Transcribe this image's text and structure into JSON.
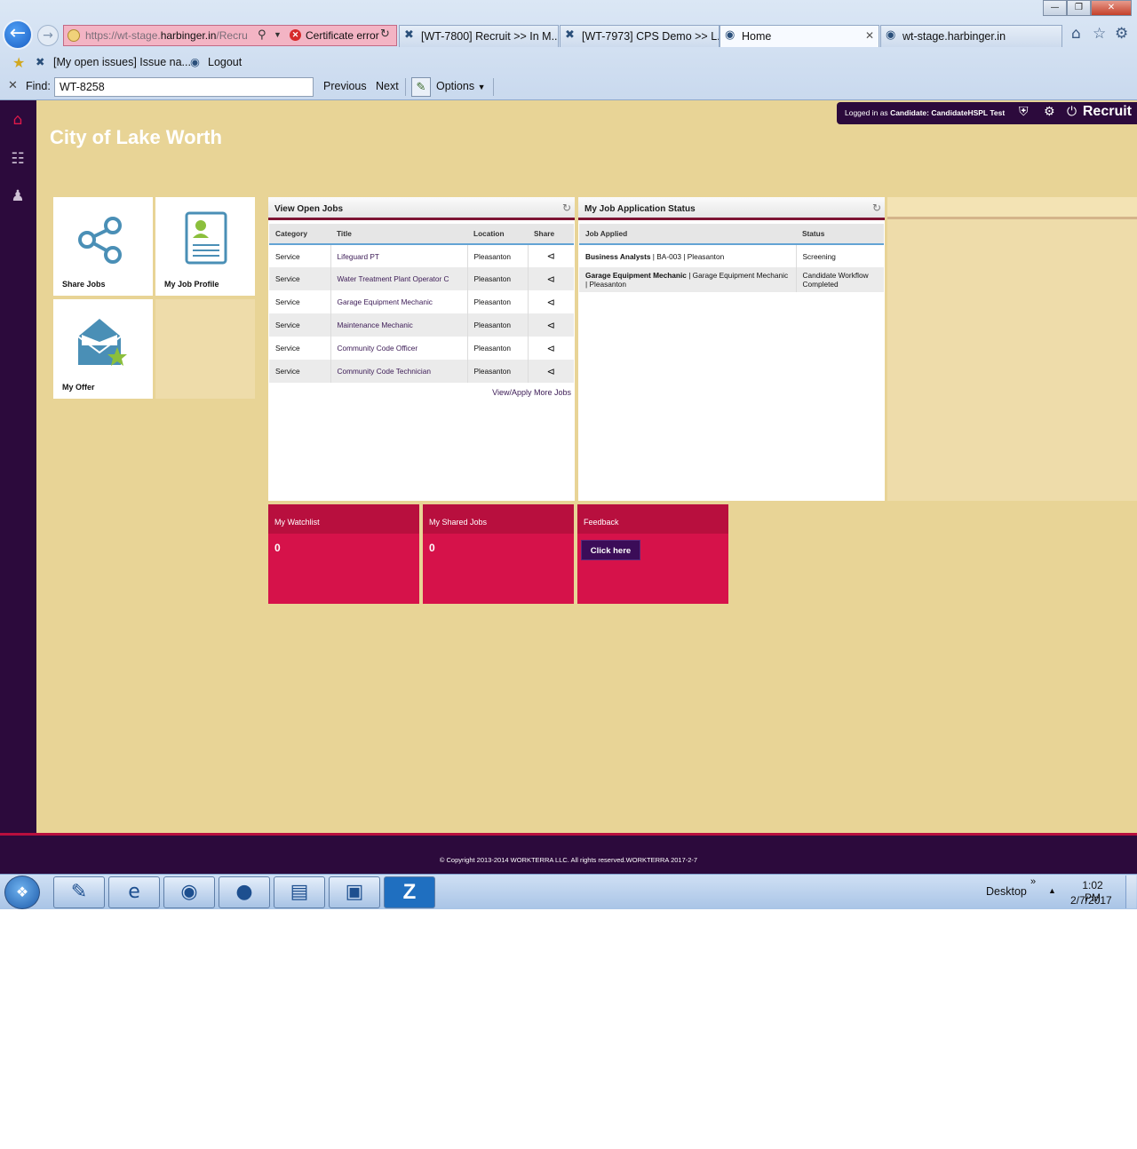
{
  "browser": {
    "url_prefix": "https://wt-stage.",
    "url_domain": "harbinger.in",
    "url_suffix": "/Recru",
    "cert_error": "Certificate error",
    "tabs": [
      {
        "label": "[WT-7800] Recruit >> In M..."
      },
      {
        "label": "[WT-7973] CPS Demo >> L..."
      },
      {
        "label": "Home"
      },
      {
        "label": "wt-stage.harbinger.in"
      }
    ],
    "favorites": [
      {
        "label": "[My open issues] Issue na..."
      },
      {
        "label": "Logout"
      }
    ],
    "find": {
      "label": "Find:",
      "value": "WT-8258",
      "previous": "Previous",
      "next": "Next",
      "options": "Options"
    }
  },
  "app": {
    "org_title": "City of Lake Worth",
    "brand": "Recruit",
    "login": {
      "prefix": "Logged in as",
      "role": "Candidate:",
      "user": "CandidateHSPL Test"
    },
    "tiles": [
      {
        "label": "Share Jobs"
      },
      {
        "label": "My Job Profile"
      },
      {
        "label": "My Offer"
      }
    ],
    "open_jobs": {
      "title": "View Open Jobs",
      "columns": [
        "Category",
        "Title",
        "Location",
        "Share"
      ],
      "rows": [
        {
          "category": "Service",
          "title": "Lifeguard PT",
          "location": "Pleasanton"
        },
        {
          "category": "Service",
          "title": "Water Treatment Plant Operator C",
          "location": "Pleasanton"
        },
        {
          "category": "Service",
          "title": "Garage Equipment Mechanic",
          "location": "Pleasanton"
        },
        {
          "category": "Service",
          "title": "Maintenance Mechanic",
          "location": "Pleasanton"
        },
        {
          "category": "Service",
          "title": "Community Code Officer",
          "location": "Pleasanton"
        },
        {
          "category": "Service",
          "title": "Community Code Technician",
          "location": "Pleasanton"
        }
      ],
      "more_link": "View/Apply More Jobs"
    },
    "app_status": {
      "title": "My Job Application Status",
      "columns": [
        "Job Applied",
        "Status"
      ],
      "rows": [
        {
          "job": "Business Analysts",
          "detail": "| BA-003 | Pleasanton",
          "status": "Screening"
        },
        {
          "job": "Garage Equipment Mechanic",
          "detail": "| Garage Equipment Mechanic | Pleasanton",
          "status": "Candidate Workflow Completed"
        }
      ]
    },
    "stats": {
      "watchlist": {
        "label": "My Watchlist",
        "value": "0"
      },
      "shared": {
        "label": "My Shared Jobs",
        "value": "0"
      },
      "feedback": {
        "label": "Feedback",
        "button": "Click here"
      }
    },
    "footer": "© Copyright 2013-2014 WORKTERRA LLC. All rights reserved.WORKTERRA 2017-2-7"
  },
  "taskbar": {
    "desktop": "Desktop",
    "time": "1:02 PM",
    "date": "2/7/2017"
  },
  "colors": {
    "app_bg": "#e8d496",
    "sidebar": "#2c0a3c",
    "accent": "#d6124a",
    "header_rule": "#7d1433"
  }
}
